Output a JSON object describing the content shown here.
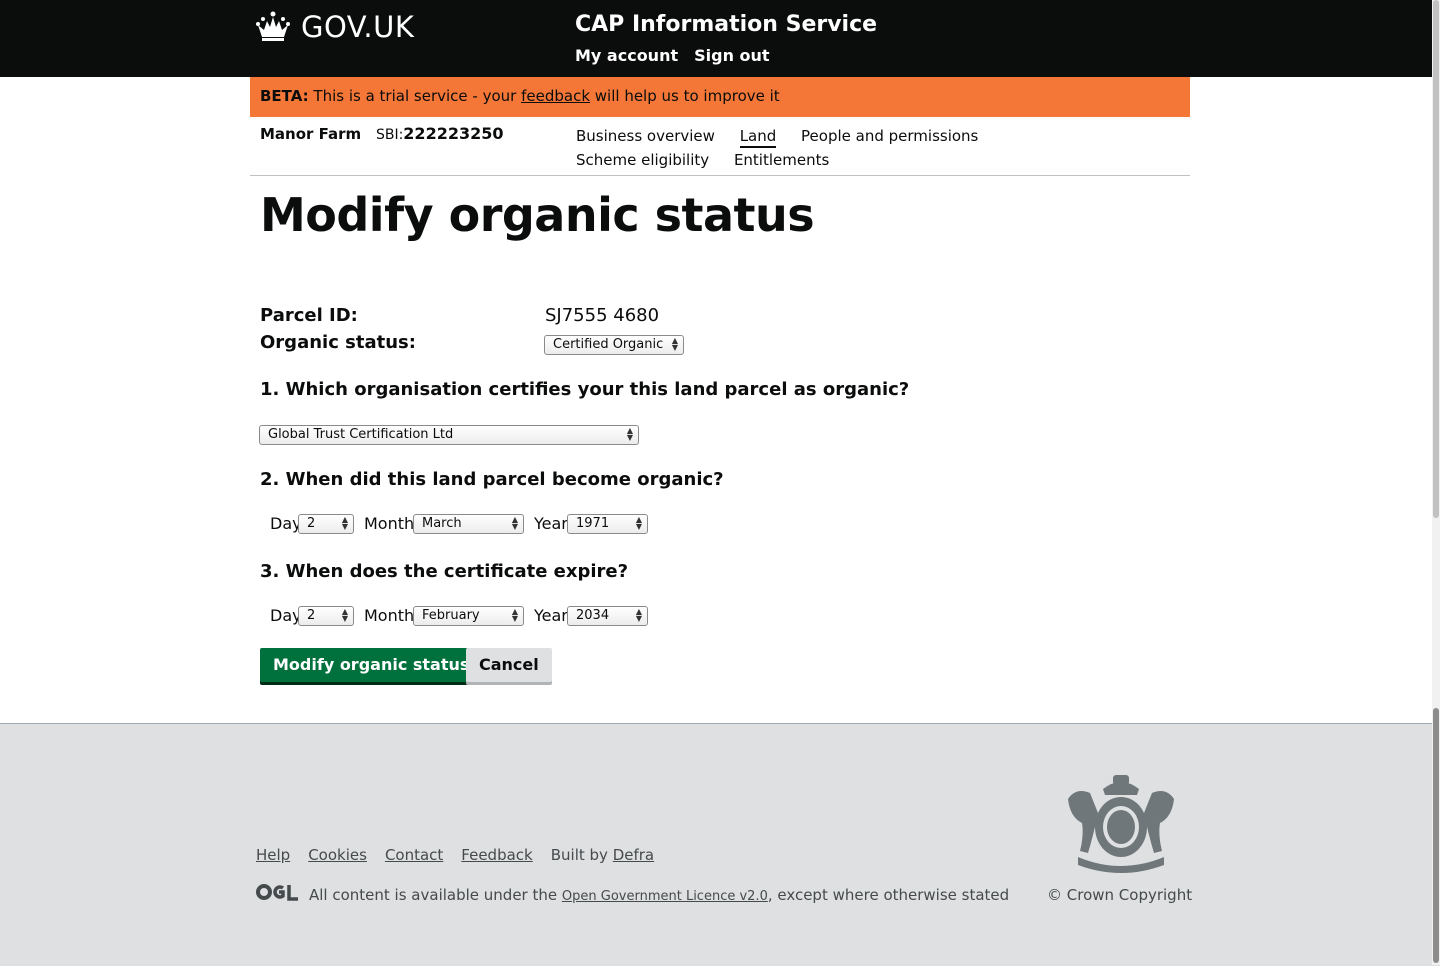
{
  "header": {
    "logo_text": "GOV.UK",
    "service_name": "CAP Information Service",
    "nav": [
      "My account",
      "Sign out"
    ]
  },
  "beta": {
    "tag": "BETA:",
    "text_before": "This is a trial service - your",
    "link": "feedback",
    "text_after": "will help us to improve it"
  },
  "business": {
    "name": "Manor Farm",
    "sbi_label": "SBI:",
    "sbi": "222223250"
  },
  "nav": {
    "items": [
      "Business overview",
      "Land",
      "People and permissions",
      "Scheme eligibility",
      "Entitlements"
    ],
    "active": "Land"
  },
  "page": {
    "title": "Modify organic status",
    "parcel_label": "Parcel ID:",
    "parcel_value": "SJ7555 4680",
    "status_label": "Organic status:",
    "status_value": "Certified Organic"
  },
  "q1": {
    "label": "1. Which organisation certifies your this land parcel as organic?",
    "value": "Global Trust Certification Ltd"
  },
  "q2": {
    "label": "2. When did this land parcel become organic?",
    "day_label": "Day",
    "day": "2",
    "month_label": "Month",
    "month": "March",
    "year_label": "Year",
    "year": "1971"
  },
  "q3": {
    "label": "3. When does the certificate expire?",
    "day_label": "Day",
    "day": "2",
    "month_label": "Month",
    "month": "February",
    "year_label": "Year",
    "year": "2034"
  },
  "buttons": {
    "primary": "Modify organic status",
    "cancel": "Cancel"
  },
  "footer": {
    "links": [
      "Help",
      "Cookies",
      "Contact",
      "Feedback"
    ],
    "built_by": "Built by",
    "built_by_link": "Defra",
    "licence_before": "All content is available under the",
    "licence_link": "Open Government Licence v2.0",
    "licence_after": ", except where otherwise stated",
    "copyright": "© Crown Copyright"
  }
}
